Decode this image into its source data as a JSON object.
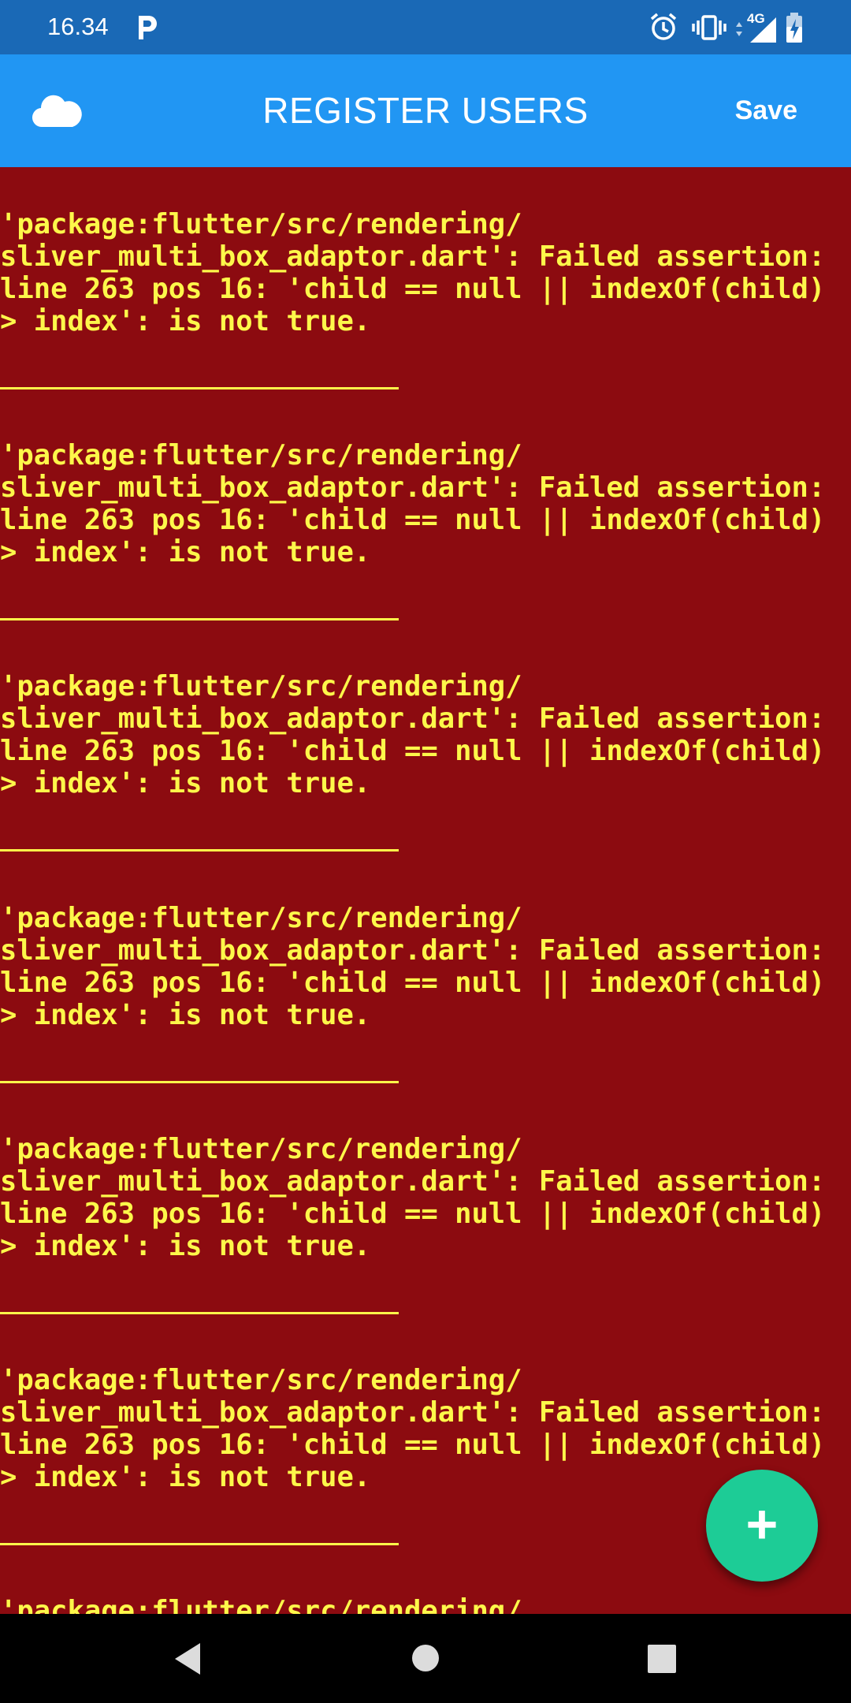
{
  "status_bar": {
    "time": "16.34",
    "network": "4G"
  },
  "app_bar": {
    "title": "REGISTER USERS",
    "save_label": "Save",
    "leading_icon": "cloud-icon"
  },
  "errors": [
    {
      "line1": "'package:flutter/src/rendering/",
      "line2": "sliver_multi_box_adaptor.dart': Failed assertion:",
      "line3": "line 263 pos 16: 'child == null || indexOf(child)",
      "line4": "> index': is not true."
    },
    {
      "line1": "'package:flutter/src/rendering/",
      "line2": "sliver_multi_box_adaptor.dart': Failed assertion:",
      "line3": "line 263 pos 16: 'child == null || indexOf(child)",
      "line4": "> index': is not true."
    },
    {
      "line1": "'package:flutter/src/rendering/",
      "line2": "sliver_multi_box_adaptor.dart': Failed assertion:",
      "line3": "line 263 pos 16: 'child == null || indexOf(child)",
      "line4": "> index': is not true."
    },
    {
      "line1": "'package:flutter/src/rendering/",
      "line2": "sliver_multi_box_adaptor.dart': Failed assertion:",
      "line3": "line 263 pos 16: 'child == null || indexOf(child)",
      "line4": "> index': is not true."
    },
    {
      "line1": "'package:flutter/src/rendering/",
      "line2": "sliver_multi_box_adaptor.dart': Failed assertion:",
      "line3": "line 263 pos 16: 'child == null || indexOf(child)",
      "line4": "> index': is not true."
    },
    {
      "line1": "'package:flutter/src/rendering/",
      "line2": "sliver_multi_box_adaptor.dart': Failed assertion:",
      "line3": "line 263 pos 16: 'child == null || indexOf(child)",
      "line4": "> index': is not true."
    },
    {
      "line1": "'package:flutter/src/rendering/",
      "line2": "",
      "line3": "",
      "line4": ""
    }
  ],
  "fab": {
    "label": "+",
    "icon": "plus-icon"
  },
  "colors": {
    "status_bar": "#1a69b6",
    "app_bar": "#2196f3",
    "error_background": "#8c0b10",
    "error_text": "#fdf74a",
    "fab": "#1dcc96"
  },
  "nav_bar": {
    "buttons": [
      "back-icon",
      "home-icon",
      "recents-icon"
    ]
  }
}
